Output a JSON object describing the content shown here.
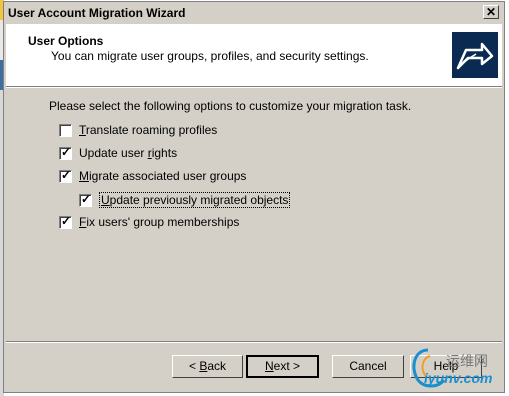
{
  "window": {
    "title": "User Account Migration Wizard",
    "close_glyph": "✕"
  },
  "header": {
    "title": "User Options",
    "subtitle": "You can migrate user groups, profiles, and security settings.",
    "icon": "wizard-arrow-icon"
  },
  "body": {
    "prompt": "Please select the following options to customize your migration task.",
    "options": [
      {
        "accel": "T",
        "rest": "ranslate roaming profiles",
        "checked": false
      },
      {
        "accel": "",
        "pre": "Update user ",
        "post": "ights",
        "accel_mid": "r",
        "checked": true
      },
      {
        "accel": "M",
        "rest": "igrate associated user groups",
        "checked": true
      },
      {
        "accel": "U",
        "rest": "pdate previously migrated objects",
        "checked": true
      },
      {
        "accel": "F",
        "rest": "ix users' group memberships",
        "checked": true
      }
    ]
  },
  "buttons": {
    "back_prefix": "< ",
    "back_accel": "B",
    "back_rest": "ack",
    "next_accel": "N",
    "next_rest": "ext >",
    "cancel": "Cancel",
    "help": "Help"
  },
  "watermark": {
    "cn": "运维网",
    "en": "iyunv.com"
  },
  "colors": {
    "dialog_bg": "#d4d0c8",
    "header_bg": "#ffffff",
    "icon_bg": "#0a2a52",
    "watermark_blue": "#1a8fd0"
  }
}
